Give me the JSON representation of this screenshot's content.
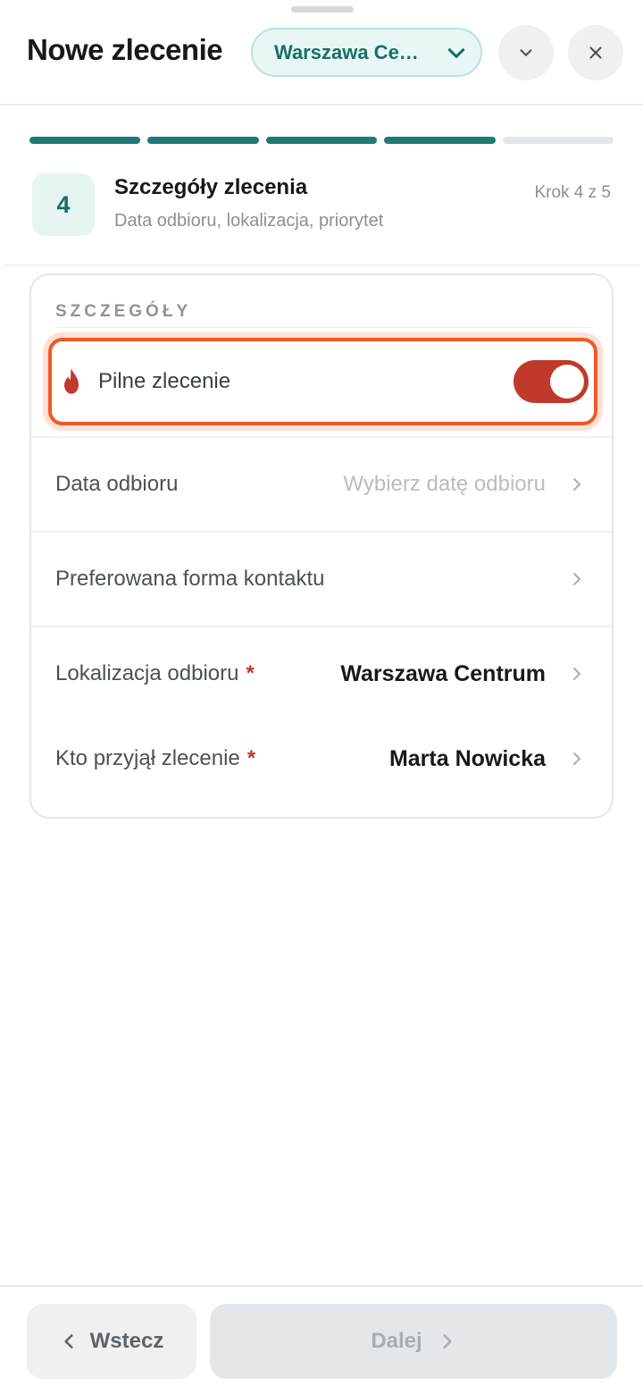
{
  "header": {
    "title": "Nowe zlecenie",
    "location_selector": {
      "value": "Warszawa Ce…",
      "icon": "chevron-down-icon"
    },
    "expand_icon": "chevron-down-icon",
    "close_icon": "close-icon"
  },
  "progress": {
    "total_steps": 5,
    "completed_steps": 4
  },
  "step": {
    "number": "4",
    "title": "Szczegóły zlecenia",
    "subtitle": "Data odbioru, lokalizacja, priorytet",
    "counter": "Krok 4 z 5"
  },
  "details": {
    "section_label": "SZCZEGÓŁY",
    "urgent": {
      "label": "Pilne zlecenie",
      "enabled": true,
      "icon": "flame-icon"
    },
    "rows": [
      {
        "label": "Data odbioru",
        "value": "Wybierz datę odbioru",
        "placeholder": true,
        "required": false
      },
      {
        "label": "Preferowana forma kontaktu",
        "value": "",
        "placeholder": false,
        "required": false
      },
      {
        "label": "Lokalizacja odbioru",
        "value": "Warszawa Centrum",
        "placeholder": false,
        "required": true,
        "required_mark": "*"
      },
      {
        "label": "Kto przyjął zlecenie",
        "value": "Marta Nowicka",
        "placeholder": false,
        "required": true,
        "required_mark": "*"
      }
    ]
  },
  "footer": {
    "back_label": "Wstecz",
    "next_label": "Dalej",
    "next_enabled": false
  },
  "colors": {
    "accent": "#1f7a73",
    "urgent_outline": "#ef5a25",
    "toggle_on": "#c0392b",
    "required": "#c0392b"
  }
}
